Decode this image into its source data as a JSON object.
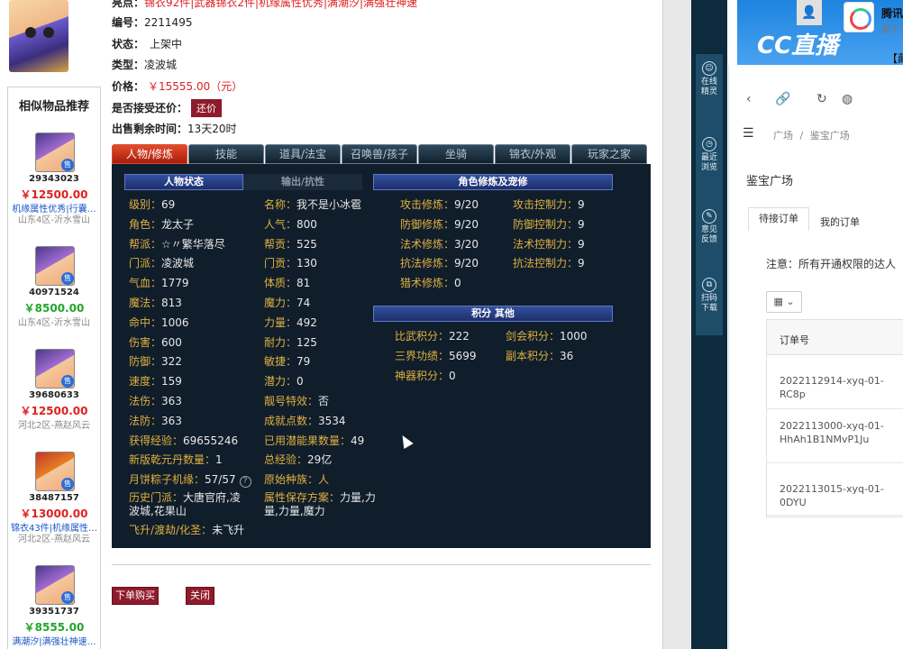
{
  "item": {
    "top_line_label": "亮点：",
    "top_line_value": "锦衣92件|武器锦衣2件|机缘属性优秀|满潮汐|满强壮神速",
    "id_label": "编号：",
    "id_value": "2211495",
    "status_label": "状态：",
    "status_value": "上架中",
    "type_label": "类型：",
    "type_value": "凌波城",
    "price_label": "价格：",
    "price_value": "￥15555.00（元）",
    "counter_label": "是否接受还价：",
    "counter_button": "还价",
    "time_label": "出售剩余时间：",
    "time_value": "13天20时"
  },
  "sidebar": {
    "title": "相似物品推荐",
    "items": [
      {
        "id": "29343023",
        "price": "￥12500.00",
        "price_color": "red",
        "note": "机缘属性优秀|行囊…",
        "server": "山东4区-沂水雪山"
      },
      {
        "id": "40971524",
        "price": "￥8500.00",
        "price_color": "green",
        "note": "",
        "server": "山东4区-沂水雪山"
      },
      {
        "id": "39680633",
        "price": "￥12500.00",
        "price_color": "red",
        "note": "",
        "server": "河北2区-燕赵风云"
      },
      {
        "id": "38487157",
        "price": "￥13000.00",
        "price_color": "red",
        "note": "锦衣43件|机缘属性…",
        "server": "河北2区-燕赵风云"
      },
      {
        "id": "39351737",
        "price": "￥8555.00",
        "price_color": "green",
        "note": "满潮汐|满强壮神速…",
        "server": ""
      }
    ],
    "tag": "售"
  },
  "tabs": [
    "人物/修炼",
    "技能",
    "道具/法宝",
    "召唤兽/孩子",
    "坐骑",
    "锦衣/外观",
    "玩家之家"
  ],
  "panel": {
    "head_status": "人物状态",
    "head_output": "输出/抗性",
    "head_cultivation": "角色修炼及宠修",
    "head_score": "积分 其他",
    "left_col": [
      {
        "k": "级别：",
        "v": "69"
      },
      {
        "k": "角色：",
        "v": "龙太子"
      },
      {
        "k": "帮派：",
        "v": "☆〃繁华落尽"
      },
      {
        "k": "门派：",
        "v": "凌波城"
      },
      {
        "k": "气血：",
        "v": "1779"
      },
      {
        "k": "魔法：",
        "v": "813"
      },
      {
        "k": "命中：",
        "v": "1006"
      },
      {
        "k": "伤害：",
        "v": "600"
      },
      {
        "k": "防御：",
        "v": "322"
      },
      {
        "k": "速度：",
        "v": "159"
      },
      {
        "k": "法伤：",
        "v": "363"
      },
      {
        "k": "法防：",
        "v": "363"
      },
      {
        "k": "获得经验：",
        "v": "69655246"
      },
      {
        "k": "新版乾元丹数量：",
        "v": "1"
      },
      {
        "k": "月饼粽子机缘：",
        "v": "57/57"
      },
      {
        "k": "历史门派：",
        "v": "大唐官府,凌波城,花果山"
      },
      {
        "k": "飞升/渡劫/化圣：",
        "v": "未飞升"
      }
    ],
    "mid_col": [
      {
        "k": "名称：",
        "v": "我不是小冰雹"
      },
      {
        "k": "人气：",
        "v": "800"
      },
      {
        "k": "帮贡：",
        "v": "525"
      },
      {
        "k": "门贡：",
        "v": "130"
      },
      {
        "k": "体质：",
        "v": "81"
      },
      {
        "k": "魔力：",
        "v": "74"
      },
      {
        "k": "力量：",
        "v": "492"
      },
      {
        "k": "耐力：",
        "v": "125"
      },
      {
        "k": "敏捷：",
        "v": "79"
      },
      {
        "k": "潜力：",
        "v": "0"
      },
      {
        "k": "靓号特效：",
        "v": "否"
      },
      {
        "k": "成就点数：",
        "v": "3534"
      },
      {
        "k": "已用潜能果数量：",
        "v": "49"
      },
      {
        "k": "总经验：",
        "v": "29亿"
      },
      {
        "k": "原始种族：",
        "v": "人"
      },
      {
        "k": "属性保存方案：",
        "v": "力量,力量,力量,魔力"
      }
    ],
    "cult_left": [
      {
        "k": "攻击修炼：",
        "v": "9/20"
      },
      {
        "k": "防御修炼：",
        "v": "9/20"
      },
      {
        "k": "法术修炼：",
        "v": "3/20"
      },
      {
        "k": "抗法修炼：",
        "v": "9/20"
      },
      {
        "k": "猎术修炼：",
        "v": "0"
      }
    ],
    "cult_right": [
      {
        "k": "攻击控制力：",
        "v": "9"
      },
      {
        "k": "防御控制力：",
        "v": "9"
      },
      {
        "k": "法术控制力：",
        "v": "9"
      },
      {
        "k": "抗法控制力：",
        "v": "9"
      }
    ],
    "score_left": [
      {
        "k": "比武积分：",
        "v": "222"
      },
      {
        "k": "三界功绩：",
        "v": "5699"
      },
      {
        "k": "神器积分：",
        "v": "0"
      }
    ],
    "score_right": [
      {
        "k": "剑会积分：",
        "v": "1000"
      },
      {
        "k": "副本积分：",
        "v": "36"
      }
    ]
  },
  "actions": {
    "buy": "下单购买",
    "close": "关闭"
  },
  "float_bar": [
    {
      "icon": "☺",
      "label1": "在线",
      "label2": "精灵"
    },
    {
      "icon": "◷",
      "label1": "最近",
      "label2": "浏览"
    },
    {
      "icon": "✎",
      "label1": "意见",
      "label2": "反馈"
    },
    {
      "icon": "⧉",
      "label1": "扫码",
      "label2": "下载"
    }
  ],
  "right": {
    "logo": "CC直播",
    "top_name": "腾讯",
    "top_name2": "娶子",
    "top_sub": "【藏",
    "breadcrumb_1": "广场",
    "breadcrumb_sep": "/",
    "breadcrumb_2": "鉴宝广场",
    "title": "鉴宝广场",
    "tab_active": "待接订单",
    "tab_2": "我的订单",
    "notice": "注意：所有开通权限的达人",
    "grid_button": "▦ ⌄",
    "table_header": "订单号",
    "orders": [
      "2022112914-xyq-01-RC8p",
      "2022113000-xyq-01-HhAh1B1NMvP1Ju",
      "2022113015-xyq-01-0DYU"
    ]
  }
}
